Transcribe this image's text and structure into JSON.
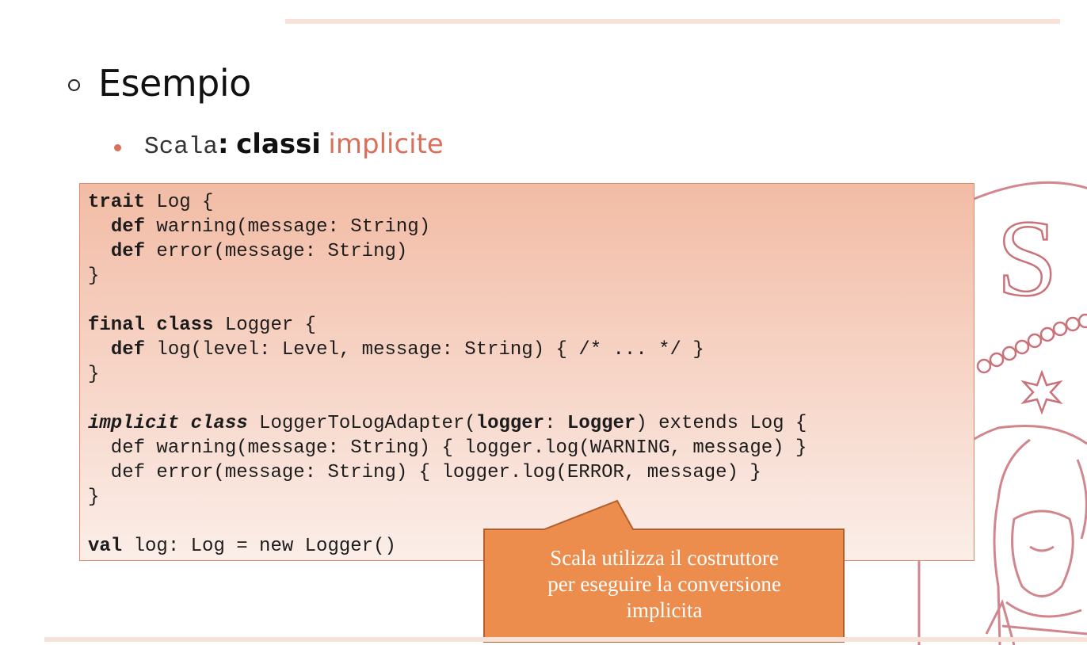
{
  "slide": {
    "title": "Esempio",
    "subtitle": {
      "mono_part": "Scala",
      "separator": ":",
      "bold_part": "classi",
      "accent_part": "implicite"
    },
    "code_lines": [
      [
        {
          "k": "kw",
          "t": "trait"
        },
        {
          "k": "n",
          "t": " Log {"
        }
      ],
      [
        {
          "k": "n",
          "t": "  "
        },
        {
          "k": "kw",
          "t": "def"
        },
        {
          "k": "n",
          "t": " warning(message: String)"
        }
      ],
      [
        {
          "k": "n",
          "t": "  "
        },
        {
          "k": "kw",
          "t": "def"
        },
        {
          "k": "n",
          "t": " error(message: String)"
        }
      ],
      [
        {
          "k": "n",
          "t": "}"
        }
      ],
      [
        {
          "k": "n",
          "t": ""
        }
      ],
      [
        {
          "k": "kw",
          "t": "final class"
        },
        {
          "k": "n",
          "t": " Logger {"
        }
      ],
      [
        {
          "k": "n",
          "t": "  "
        },
        {
          "k": "kw",
          "t": "def"
        },
        {
          "k": "n",
          "t": " log(level: Level, message: String) { /* ... */ }"
        }
      ],
      [
        {
          "k": "n",
          "t": "}"
        }
      ],
      [
        {
          "k": "n",
          "t": ""
        }
      ],
      [
        {
          "k": "kwi",
          "t": "implicit class"
        },
        {
          "k": "n",
          "t": " LoggerToLogAdapter("
        },
        {
          "k": "kw",
          "t": "logger"
        },
        {
          "k": "n",
          "t": ": "
        },
        {
          "k": "kw",
          "t": "Logger"
        },
        {
          "k": "n",
          "t": ") extends Log {"
        }
      ],
      [
        {
          "k": "n",
          "t": "  def warning(message: String) { logger.log(WARNING, message) }"
        }
      ],
      [
        {
          "k": "n",
          "t": "  def error(message: String) { logger.log(ERROR, message) }"
        }
      ],
      [
        {
          "k": "n",
          "t": "}"
        }
      ],
      [
        {
          "k": "n",
          "t": ""
        }
      ],
      [
        {
          "k": "kw",
          "t": "val"
        },
        {
          "k": "n",
          "t": " log: Log = new Logger()"
        }
      ]
    ],
    "callout": {
      "lines": [
        "Scala utilizza il costruttore",
        "per  eseguire la conversione",
        "implicita"
      ]
    },
    "colors": {
      "accent": "#d8705a",
      "callout_fill": "#ec8d4d",
      "callout_border": "#b55f2e",
      "code_border": "#e0896a",
      "seal": "#c9727a"
    },
    "icons": {
      "bullet_level1": "hollow-circle-bullet",
      "bullet_level2": "filled-dot-bullet",
      "background": "university-seal-watermark"
    }
  }
}
